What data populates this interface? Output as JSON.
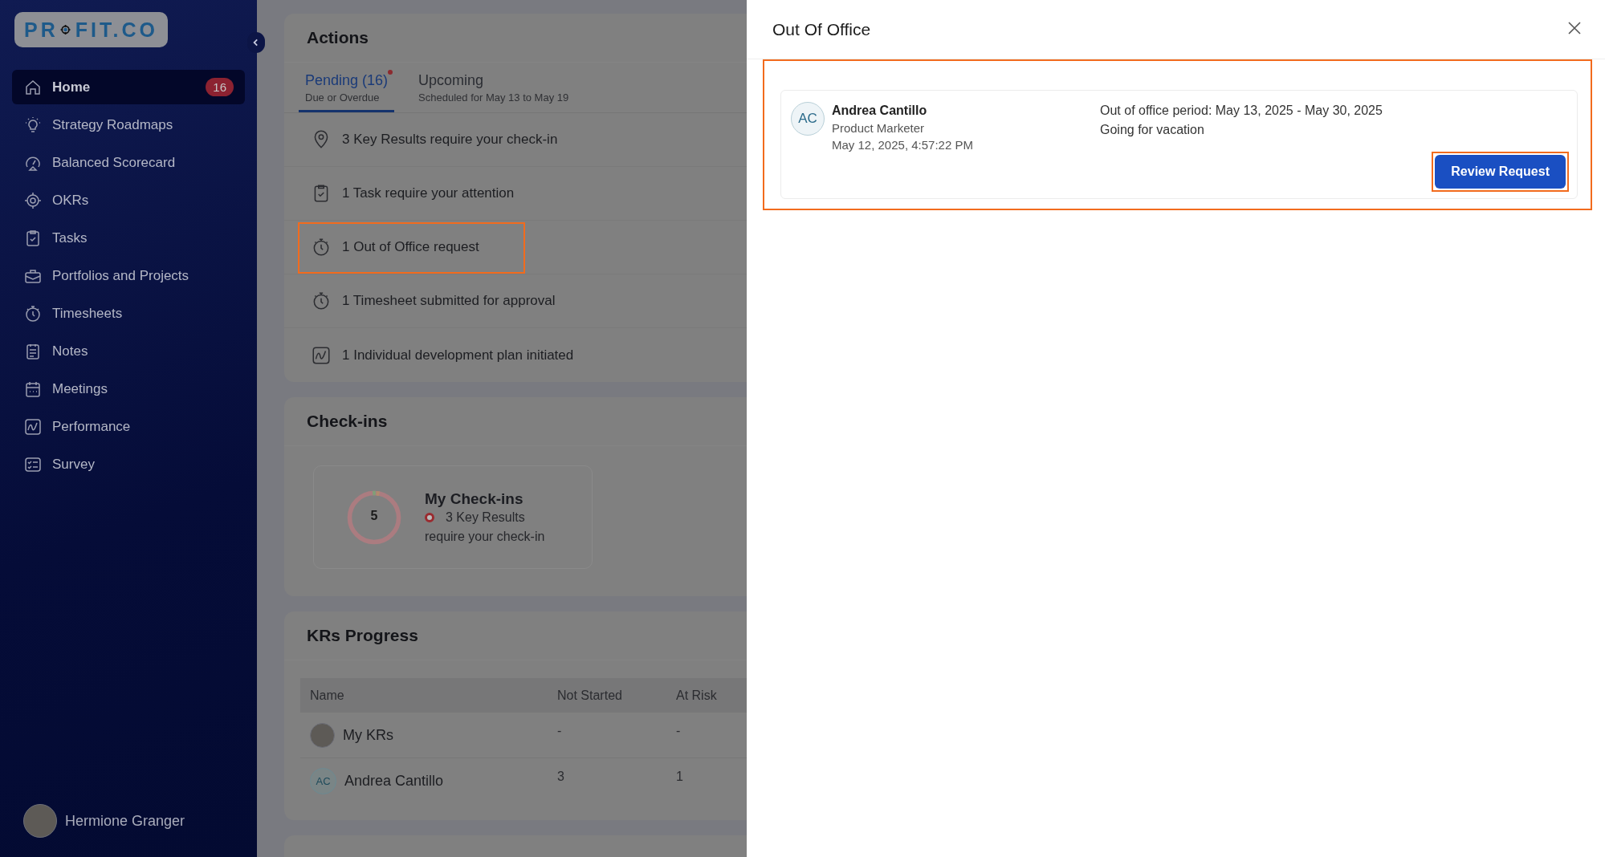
{
  "sidebar": {
    "logo": {
      "start": "PR",
      "end": "FIT.CO"
    },
    "nav": [
      {
        "label": "Home",
        "kind": "home",
        "selected": true,
        "badge": "16"
      },
      {
        "label": "Strategy Roadmaps",
        "kind": "bulb",
        "selected": false
      },
      {
        "label": "Balanced Scorecard",
        "kind": "gauge",
        "selected": false
      },
      {
        "label": "OKRs",
        "kind": "target",
        "selected": false
      },
      {
        "label": "Tasks",
        "kind": "clipboard",
        "selected": false
      },
      {
        "label": "Portfolios and Projects",
        "kind": "briefcase",
        "selected": false
      },
      {
        "label": "Timesheets",
        "kind": "stopwatch",
        "selected": false
      },
      {
        "label": "Notes",
        "kind": "notes",
        "selected": false
      },
      {
        "label": "Meetings",
        "kind": "calendar",
        "selected": false
      },
      {
        "label": "Performance",
        "kind": "chart",
        "selected": false
      },
      {
        "label": "Survey",
        "kind": "checklist",
        "selected": false
      }
    ],
    "user": {
      "name": "Hermione Granger"
    }
  },
  "actions": {
    "title": "Actions",
    "tabs": [
      {
        "label": "Pending (16)",
        "subtitle": "Due or Overdue",
        "selected": true,
        "dot": true
      },
      {
        "label": "Upcoming",
        "subtitle": "Scheduled for May 13 to May 19",
        "selected": false,
        "dot": false
      }
    ],
    "items": [
      {
        "text": "3 Key Results require your check-in",
        "kind": "pin",
        "highlighted": false
      },
      {
        "text": "1 Task require your attention",
        "kind": "clipboard",
        "highlighted": false
      },
      {
        "text": "1 Out of Office request",
        "kind": "stopwatch",
        "highlighted": true
      },
      {
        "text": "1 Timesheet submitted for approval",
        "kind": "stopwatch",
        "highlighted": false
      },
      {
        "text": "1 Individual development plan initiated",
        "kind": "chart",
        "highlighted": false
      }
    ]
  },
  "checkins": {
    "title": "Check-ins",
    "card": {
      "count": "5",
      "title": "My Check-ins",
      "line1": "3 Key Results",
      "line2": "require your check-in"
    }
  },
  "krs_progress": {
    "title": "KRs Progress",
    "columns": [
      "Name",
      "Not Started",
      "At Risk"
    ],
    "rows": [
      {
        "avatar": {
          "kind": "photo"
        },
        "cells": [
          "My KRs",
          "-",
          "-"
        ]
      },
      {
        "avatar": {
          "kind": "initials",
          "text": "AC"
        },
        "cells": [
          "Andrea Cantillo",
          "3",
          "1"
        ]
      }
    ]
  },
  "drawer": {
    "title": "Out Of Office",
    "highlighted": true,
    "requests": [
      {
        "initials": "AC",
        "name": "Andrea Cantillo",
        "role": "Product Marketer",
        "submitted": "May 12, 2025, 4:57:22 PM",
        "period": "Out of office period: May 13, 2025 - May 30, 2025",
        "reason": "Going for vacation",
        "button": "Review Request",
        "button_highlighted": true
      }
    ]
  }
}
